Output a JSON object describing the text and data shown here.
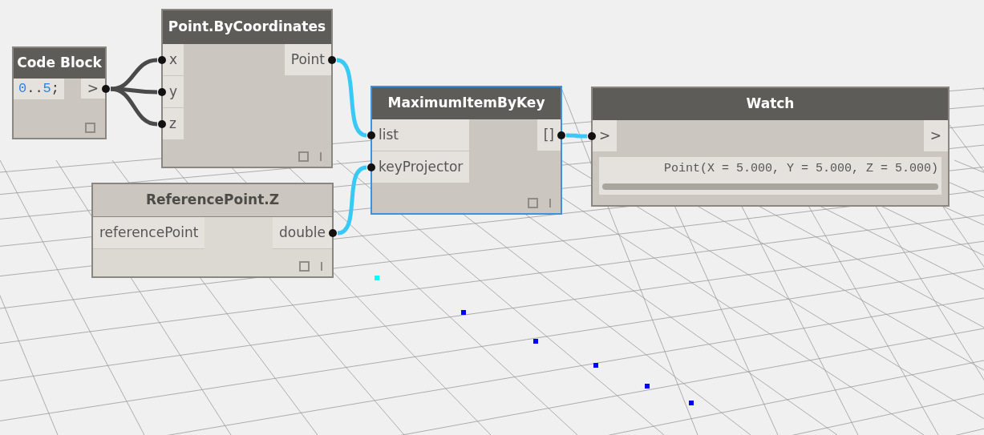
{
  "nodes": [
    {
      "kind": "code_block",
      "title": "Code Block",
      "selected": false,
      "dimmed": false,
      "code": "0..5;",
      "outputs": [
        ">"
      ]
    },
    {
      "kind": "function",
      "title": "Point.ByCoordinates",
      "selected": false,
      "dimmed": false,
      "inputs": [
        "x",
        "y",
        "z"
      ],
      "outputs": [
        "Point"
      ]
    },
    {
      "kind": "function",
      "title": "ReferencePoint.Z",
      "selected": false,
      "dimmed": true,
      "inputs": [
        "referencePoint"
      ],
      "outputs": [
        "double"
      ]
    },
    {
      "kind": "function",
      "title": "MaximumItemByKey",
      "selected": true,
      "dimmed": false,
      "inputs": [
        "list",
        "keyProjector"
      ],
      "outputs": [
        "[]"
      ]
    },
    {
      "kind": "watch",
      "title": "Watch",
      "selected": false,
      "dimmed": false,
      "inputs": [
        ">"
      ],
      "outputs": [
        ">"
      ],
      "value": "Point(X = 5.000, Y = 5.000, Z = 5.000)"
    }
  ]
}
